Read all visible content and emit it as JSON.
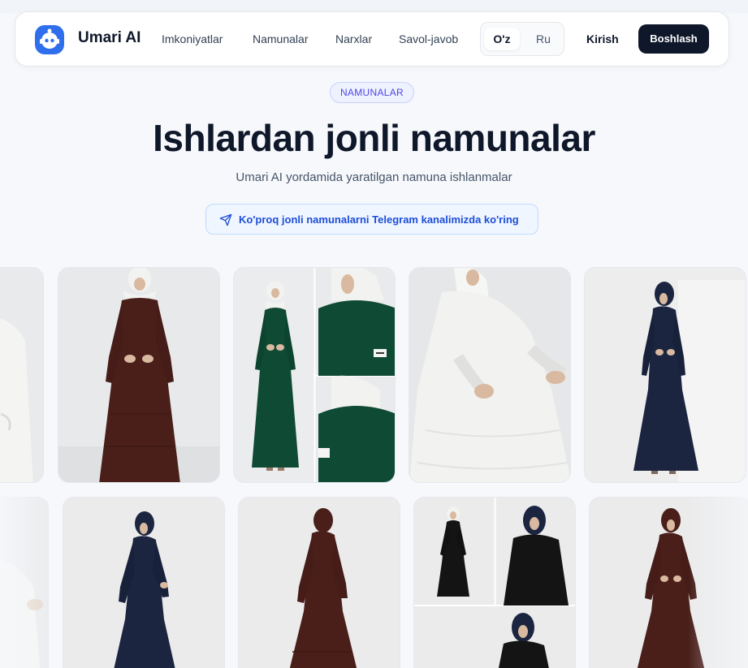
{
  "nav": {
    "brand": "Umari AI",
    "links": [
      "Imkoniyatlar",
      "Namunalar",
      "Narxlar",
      "Savol-javob"
    ],
    "lang": {
      "active": "O'z",
      "other": "Ru"
    },
    "login": "Kirish",
    "start": "Boshlash"
  },
  "hero": {
    "badge": "NAMUNALAR",
    "title": "Ishlardan jonli namunalar",
    "subtitle": "Umari AI yordamida yaratilgan namuna ishlanmalar",
    "telegram_link": "Ko'proq jonli namunalarni Telegram kanalimizda ko'ring"
  },
  "colors": {
    "brand_blue": "#2f6fed",
    "dark": "#0f172a",
    "badge_text": "#4f46e5",
    "link_blue": "#1d4ed8",
    "dress_brown": "#4a1f1a",
    "dress_green": "#0f4a34",
    "dress_white": "#f2f2f0",
    "dress_navy": "#1b2540",
    "dress_black": "#141414"
  },
  "gallery": {
    "row1": [
      {
        "kind": "white-dress-partial"
      },
      {
        "kind": "brown-dress"
      },
      {
        "kind": "green-dress-collage"
      },
      {
        "kind": "white-dress"
      },
      {
        "kind": "navy-dress"
      }
    ],
    "row2": [
      {
        "kind": "white-dress-partial"
      },
      {
        "kind": "navy-dress"
      },
      {
        "kind": "brown-dress-back"
      },
      {
        "kind": "black-dress-collage"
      },
      {
        "kind": "brown-dress"
      }
    ]
  }
}
